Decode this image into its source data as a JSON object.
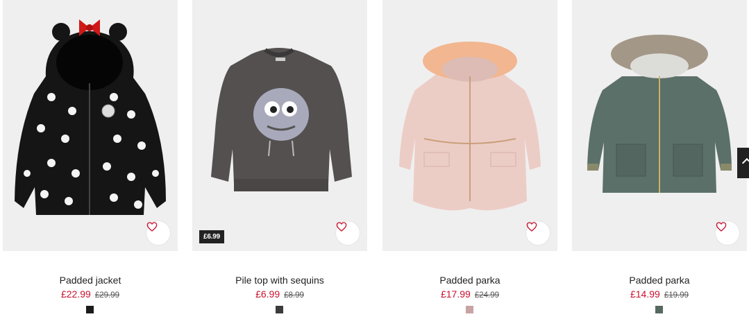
{
  "products": [
    {
      "name": "Padded jacket",
      "price": "£22.99",
      "old_price": "£29.99",
      "badge": "",
      "swatch": "#1b1b1b"
    },
    {
      "name": "Pile top with sequins",
      "price": "£6.99",
      "old_price": "£8.99",
      "badge": "£6.99",
      "swatch": "#3b3b3b"
    },
    {
      "name": "Padded parka",
      "price": "£17.99",
      "old_price": "£24.99",
      "badge": "",
      "swatch": "#c9a3a3"
    },
    {
      "name": "Padded parka",
      "price": "£14.99",
      "old_price": "£19.99",
      "badge": "",
      "swatch": "#56695f"
    }
  ],
  "icons": {
    "favourite": "heart-icon",
    "scroll": "chevron-up-icon"
  },
  "colors": {
    "sale_price": "#c8102e",
    "badge_bg": "#222222"
  }
}
